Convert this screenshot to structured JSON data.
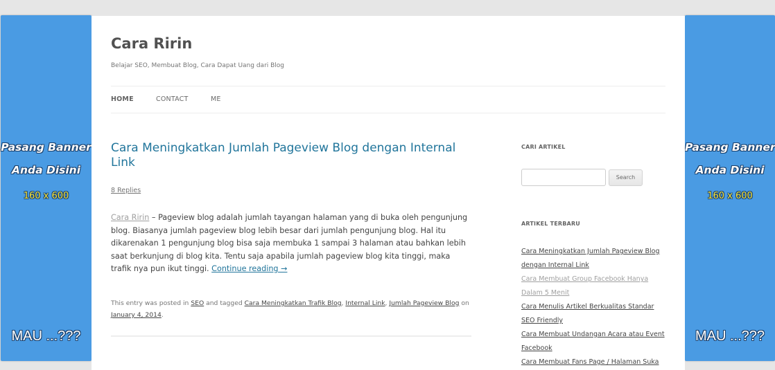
{
  "ad_left": {
    "line1": "Pasang Banner",
    "line2": "Anda Disini",
    "size": "160 x 600",
    "bottom": "MAU ...???"
  },
  "ad_right": {
    "line1": "Pasang Banner",
    "line2": "Anda Disini",
    "size": "160 x 600",
    "bottom": "MAU ...???"
  },
  "site": {
    "title": "Cara Ririn",
    "description": "Belajar SEO, Membuat Blog, Cara Dapat Uang dari Blog"
  },
  "nav": {
    "home": "HOME",
    "contact": "CONTACT",
    "me": "ME"
  },
  "post": {
    "title": "Cara Meningkatkan Jumlah Pageview Blog dengan Internal Link",
    "replies": "8 Replies",
    "author": "Cara Ririn",
    "body": " – Pageview blog adalah jumlah tayangan halaman yang di buka oleh pengunjung blog. Biasanya jumlah pageview blog lebih besar dari jumlah pengunjung blog. Hal itu dikarenakan 1 pengunjung blog bisa saja membuka 1 sampai 3 halaman atau bahkan lebih saat berkunjung di blog kita. Tentu saja apabila jumlah pageview blog kita tinggi, maka trafik nya pun ikut tinggi. ",
    "continue": "Continue reading →",
    "meta_prefix": "This entry was posted in ",
    "category": "SEO",
    "meta_tagged": " and tagged ",
    "tag1": "Cara Meningkatkan Trafik Blog",
    "sep1": ", ",
    "tag2": "Internal Link",
    "sep2": ", ",
    "tag3": "Jumlah Pageview Blog",
    "meta_on": " on ",
    "date": "January 4, 2014",
    "meta_end": "."
  },
  "sidebar": {
    "search_title": "CARI ARTIKEL",
    "search_value": "",
    "search_button": "Search",
    "recent_title": "ARTIKEL TERBARU",
    "recent": [
      "Cara Meningkatkan Jumlah Pageview Blog dengan Internal Link",
      "Cara Membuat Group Facebook Hanya Dalam 5 Menit",
      "Cara Menulis Artikel Berkualitas Standar SEO Friendly",
      "Cara Membuat Undangan Acara atau Event Facebook",
      "Cara Membuat Fans Page / Halaman Suka"
    ]
  },
  "colors": {
    "ad_blue": "#4a9be3",
    "link": "#21759b",
    "ad_yellow": "#f6e53c"
  }
}
